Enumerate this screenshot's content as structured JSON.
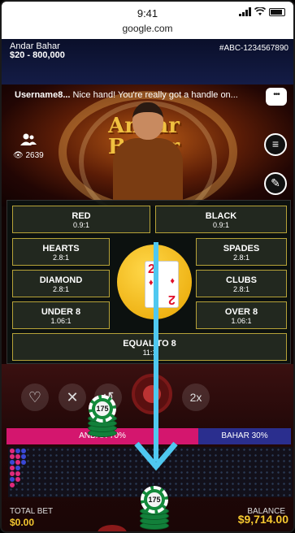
{
  "status": {
    "time": "9:41"
  },
  "browser": {
    "url": "google.com"
  },
  "header": {
    "game_title": "Andar Bahar",
    "limits": "$20 - 800,000",
    "round_id": "#ABC-1234567890"
  },
  "chat": {
    "username": "Username8...",
    "message": "Nice hand! You're really got a handle on..."
  },
  "video": {
    "logo_line1": "Andar",
    "logo_line2": "Bahar",
    "viewers": "2639"
  },
  "bets": {
    "red": {
      "label": "RED",
      "odds": "0.9:1"
    },
    "black": {
      "label": "BLACK",
      "odds": "0.9:1"
    },
    "hearts": {
      "label": "HEARTS",
      "odds": "2.8:1"
    },
    "spades": {
      "label": "SPADES",
      "odds": "2.8:1"
    },
    "diamond": {
      "label": "DIAMOND",
      "odds": "2.8:1"
    },
    "clubs": {
      "label": "CLUBS",
      "odds": "2.8:1"
    },
    "under8": {
      "label": "UNDER 8",
      "odds": "1.06:1"
    },
    "over8": {
      "label": "OVER 8",
      "odds": "1.06:1"
    },
    "equal8": {
      "label": "EQUAL TO 8",
      "odds": "11:1"
    }
  },
  "card": {
    "rank": "2",
    "suit": "diamond"
  },
  "controls": {
    "undo_label": "2x"
  },
  "split": {
    "andar": "ANDAR 70%",
    "bahar": "BAHAR 30%",
    "andar_pct": 70,
    "bahar_pct": 30
  },
  "chips": {
    "dragged_value": "175",
    "stack_value": "175"
  },
  "footer": {
    "total_bet_label": "TOTAL BET",
    "total_bet_value": "$0.00",
    "balance_label": "BALANCE",
    "balance_value": "$9,714.00"
  },
  "colors": {
    "accent_gold": "#f5c830",
    "andar_pink": "#d4166e",
    "bahar_blue": "#2a2e8e",
    "bet_border": "#b6a238",
    "arrow": "#4fc8f0"
  }
}
